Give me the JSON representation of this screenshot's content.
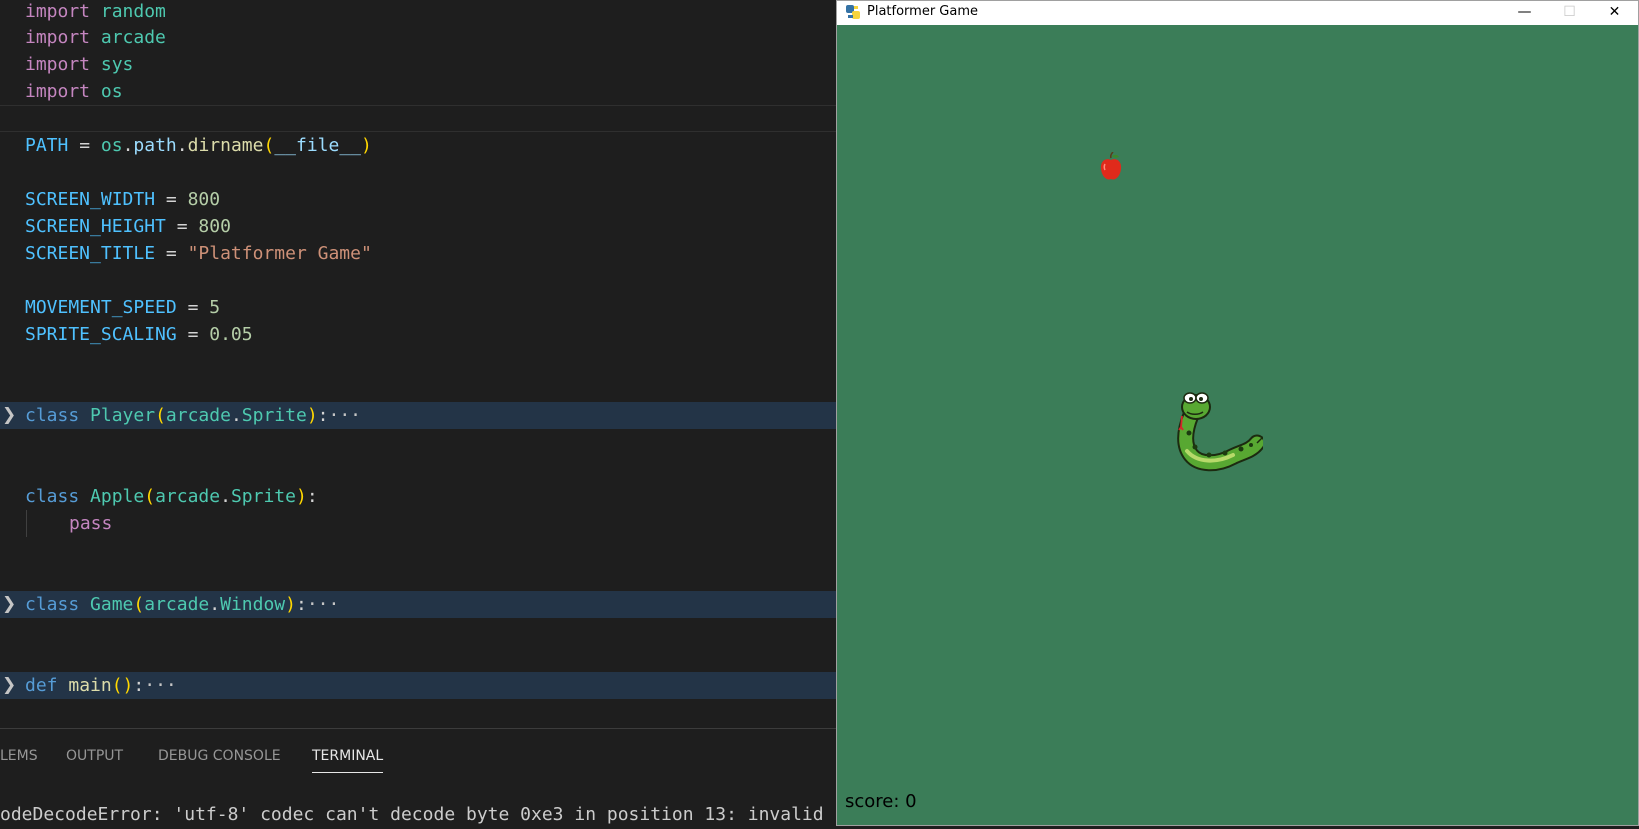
{
  "editor": {
    "imports": [
      {
        "kw": "import",
        "module": "random"
      },
      {
        "kw": "import",
        "module": "arcade"
      },
      {
        "kw": "import",
        "module": "sys"
      },
      {
        "kw": "import",
        "module": "os"
      }
    ],
    "path_line": {
      "name": "PATH",
      "eq": "=",
      "obj": "os",
      "attr1": "path",
      "fn": "dirname",
      "arg": "__file__"
    },
    "width_line": {
      "name": "SCREEN_WIDTH",
      "eq": "=",
      "value": "800"
    },
    "height_line": {
      "name": "SCREEN_HEIGHT",
      "eq": "=",
      "value": "800"
    },
    "title_line": {
      "name": "SCREEN_TITLE",
      "eq": "=",
      "value": "\"Platformer Game\""
    },
    "speed_line": {
      "name": "MOVEMENT_SPEED",
      "eq": "=",
      "value": "5"
    },
    "scaling_line": {
      "name": "SPRITE_SCALING",
      "eq": "=",
      "value": "0.05"
    },
    "player_class": {
      "kw": "class",
      "name": "Player",
      "base_mod": "arcade",
      "base": "Sprite",
      "ellipsis": "···"
    },
    "apple_class": {
      "kw": "class",
      "name": "Apple",
      "base_mod": "arcade",
      "base": "Sprite",
      "body": "pass"
    },
    "game_class": {
      "kw": "class",
      "name": "Game",
      "base_mod": "arcade",
      "base": "Window",
      "ellipsis": "···"
    },
    "main_def": {
      "kw": "def",
      "name": "main",
      "ellipsis": "···"
    }
  },
  "panel": {
    "tabs": [
      "LEMS",
      "OUTPUT",
      "DEBUG CONSOLE",
      "TERMINAL"
    ],
    "active_tab": "TERMINAL",
    "terminal_text": "odeDecodeError: 'utf-8' codec can't decode byte 0xe3 in position 13: invalid"
  },
  "game_window": {
    "title": "Platformer Game",
    "minimize_glyph": "—",
    "maximize_glyph": "☐",
    "close_glyph": "✕",
    "background_color": "#3b7d58",
    "score_label": "score: 0"
  }
}
